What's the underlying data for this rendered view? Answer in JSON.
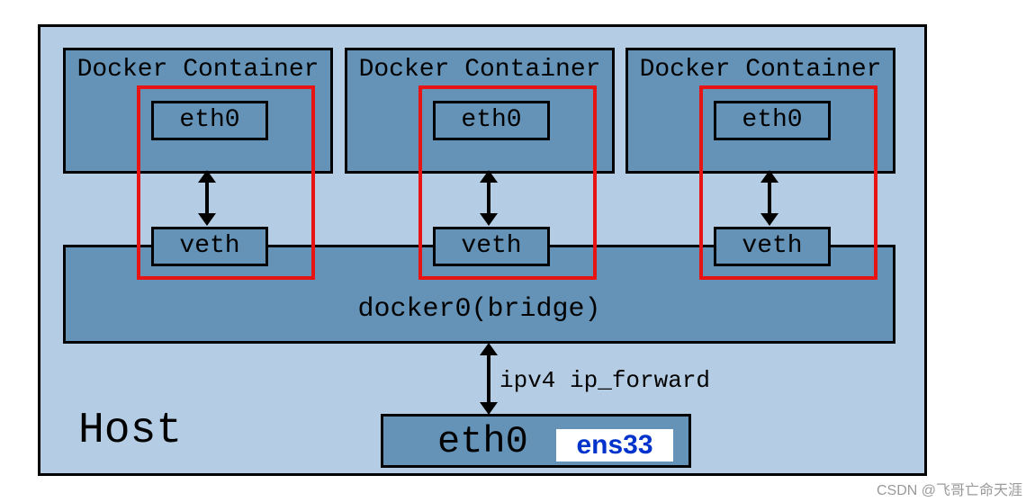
{
  "host": {
    "label": "Host"
  },
  "containers": [
    {
      "title": "Docker Container",
      "interface": "eth0"
    },
    {
      "title": "Docker Container",
      "interface": "eth0"
    },
    {
      "title": "Docker Container",
      "interface": "eth0"
    }
  ],
  "bridge": {
    "veths": [
      "veth",
      "veth",
      "veth"
    ],
    "label": "docker0(bridge)"
  },
  "forward_label": "ipv4 ip_forward",
  "host_interface": {
    "name": "eth0",
    "alias": "ens33"
  },
  "watermark": "CSDN @飞哥亡命天涯"
}
